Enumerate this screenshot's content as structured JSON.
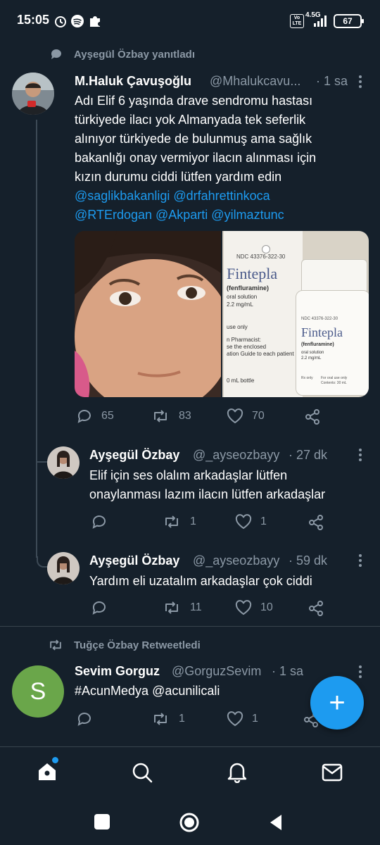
{
  "status_bar": {
    "time": "15:05",
    "network": "4.5G",
    "volte": "Vo LTE",
    "battery": "67"
  },
  "reply_context": "Ayşegül Özbay yanıtladı",
  "main_tweet": {
    "name": "M.Haluk Çavuşoğlu",
    "handle": "@Mhalukcavu...",
    "time": "· 1 sa",
    "text_lines": [
      "Adı Elif  6 yaşında  drave sendromu hastası",
      "türkiyede ilacı yok Almanyada tek seferlik",
      "alınıyor   türkiyede de bulunmuş ama sağlık",
      "bakanlığı onay vermiyor ilacın alınması için",
      "kızın durumu ciddi lütfen yardım edin"
    ],
    "mentions_line1": "@saglikbakanligi @drfahrettinkoca",
    "mentions_line2": "@RTErdogan @Akparti @yilmaztunc",
    "image_text": {
      "ndc": "NDC 43376-322-30",
      "brand": "Fintepla",
      "generic": "(fenfluramine)",
      "solution": "oral solution",
      "strength": "2.2 mg/mL",
      "use_only": "use only",
      "pharmacist": "n Pharmacist:",
      "enclosed": "se the enclosed",
      "guide": "ation Guide to each patient",
      "bottle": "0 mL bottle",
      "bottle_ndc": "NDC 43376-322-30",
      "bottle_brand": "Fintepla",
      "bottle_generic": "(fenfluramine)",
      "bottle_solution": "oral solution",
      "bottle_strength": "2.2 mg/mL",
      "bottle_rx": "Rx only",
      "bottle_oral": "For oral use only",
      "bottle_contents": "Contents: 30 mL"
    },
    "replies": "65",
    "retweets": "83",
    "likes": "70"
  },
  "reply1": {
    "name": "Ayşegül Özbay",
    "handle": "@_ayseozbayy",
    "time": "· 27 dk",
    "text_lines": [
      "Elif için ses olalım arkadaşlar lütfen",
      "onaylanması lazım ilacın lütfen arkadaşlar"
    ],
    "replies": "",
    "retweets": "1",
    "likes": "1"
  },
  "reply2": {
    "name": "Ayşegül Özbay",
    "handle": "@_ayseozbayy",
    "time": "· 59 dk",
    "text_lines": [
      "Yardım eli uzatalım arkadaşlar çok ciddi"
    ],
    "replies": "",
    "retweets": "11",
    "likes": "10"
  },
  "retweet_context": "Tuğçe Özbay Retweetledi",
  "tweet3": {
    "avatar_letter": "S",
    "name": "Sevim Gorguz",
    "handle": "@GorguzSevim",
    "time": "· 1 sa",
    "text": "#AcunMedya @acunilicali",
    "replies": "",
    "retweets": "1",
    "likes": "1"
  },
  "fab_label": "+",
  "colors": {
    "background": "#15202b",
    "accent": "#1d9bf0",
    "muted": "#8b98a5",
    "avatar_s": "#6aa64a"
  }
}
